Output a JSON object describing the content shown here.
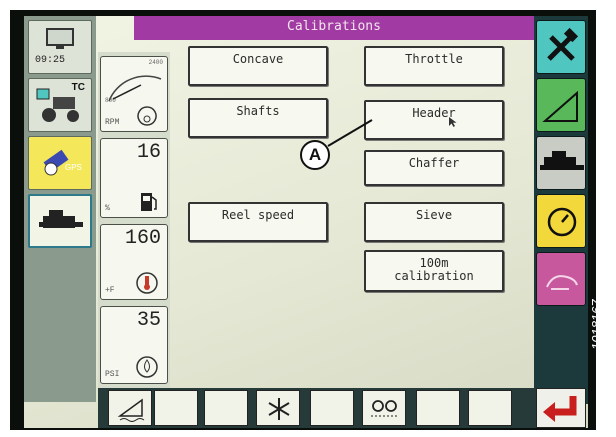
{
  "screen": {
    "title": "Calibrations"
  },
  "status": {
    "clock": "09:25",
    "gps_label": "GPS",
    "tc_label": "TC"
  },
  "gauges": [
    {
      "value": "",
      "unit": "RPM",
      "scale_max": "2400",
      "scale_min": "800",
      "icon": "engine-speed-icon"
    },
    {
      "value": "16",
      "unit": "%",
      "icon": "fuel-pump-icon"
    },
    {
      "value": "160",
      "unit": "+F",
      "icon": "coolant-temperature-icon"
    },
    {
      "value": "35",
      "unit": "PSI",
      "icon": "oil-pressure-icon"
    }
  ],
  "menu": {
    "concave": "Concave",
    "throttle": "Throttle",
    "shafts": "Shafts",
    "header": "Header",
    "chaffer": "Chaffer",
    "reel_speed": "Reel speed",
    "sieve": "Sieve",
    "calib_line1": "100m",
    "calib_line2": "calibration"
  },
  "callout": {
    "label": "A"
  },
  "document_id": "1018167",
  "colors": {
    "title_bar": "#a23aa4",
    "right_teal": "#4fc6c0",
    "right_green": "#58b85a",
    "right_yellow": "#f2d83a",
    "right_pink": "#c8589e"
  }
}
